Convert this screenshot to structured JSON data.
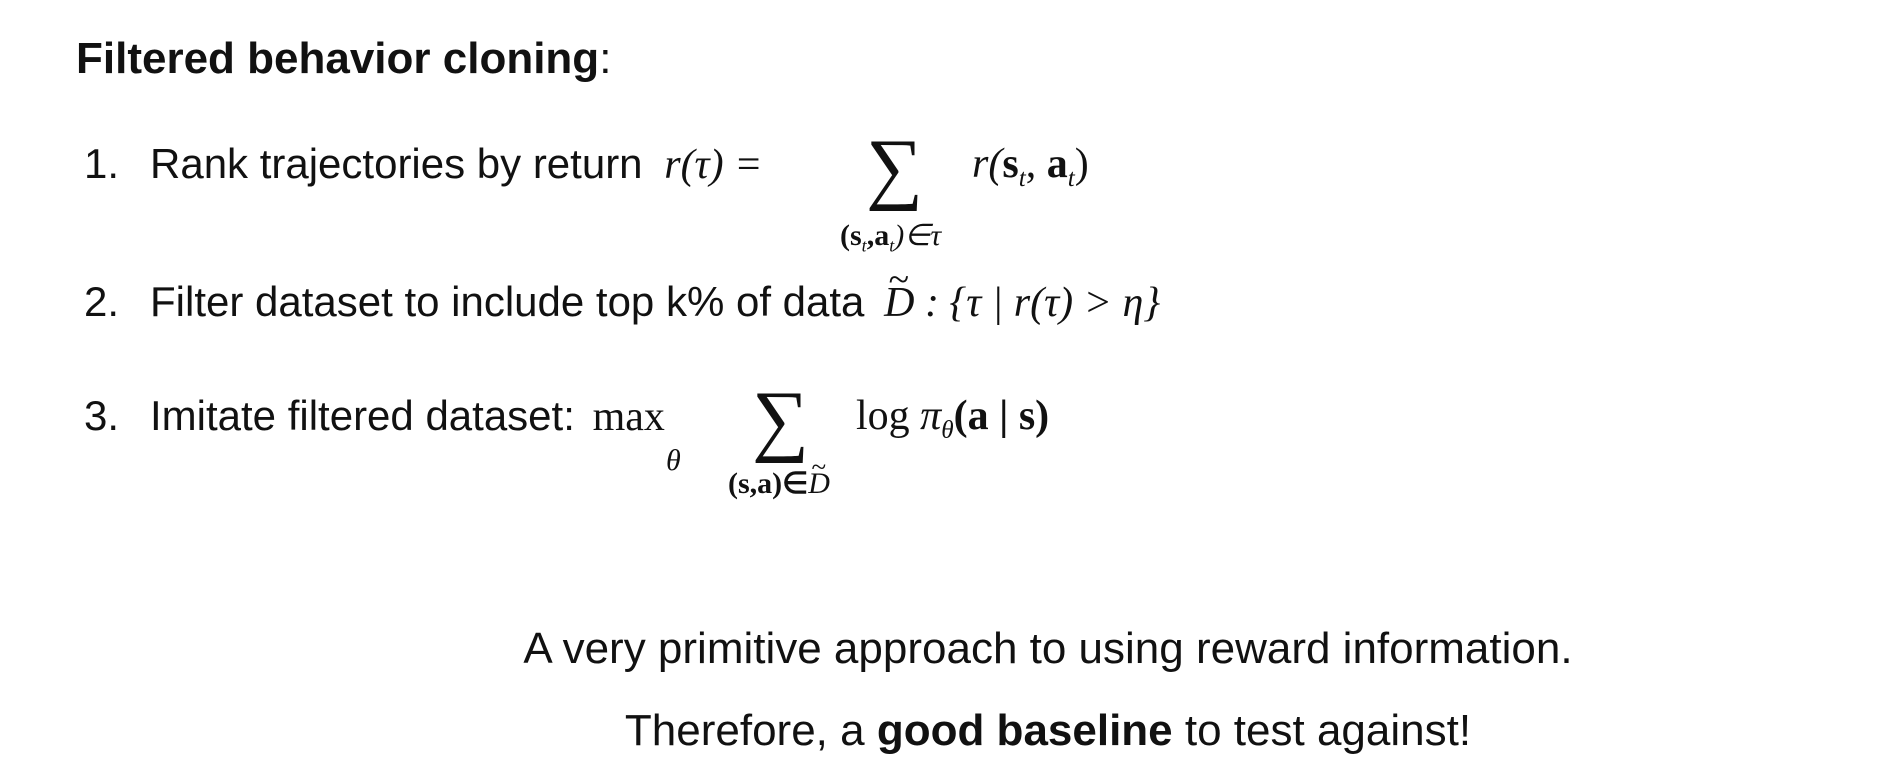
{
  "heading": {
    "bold": "Filtered behavior cloning",
    "colon": ":"
  },
  "items": [
    {
      "number": "1.",
      "text": "Rank trajectories by return",
      "math": {
        "lhs": "r(τ) =",
        "sigma": "∑",
        "under": "(s",
        "under_t1": "t",
        "under_mid": ",a",
        "under_t2": "t",
        "under_end": ")∈τ",
        "term_r": "r(",
        "term_s": "s",
        "term_t1": "t",
        "term_comma": ", ",
        "term_a": "a",
        "term_t2": "t",
        "term_close": ")"
      }
    },
    {
      "number": "2.",
      "text": "Filter dataset to include top k% of data",
      "math": {
        "D": "D",
        "set": ": {τ | r(τ) > η}"
      }
    },
    {
      "number": "3.",
      "text": "Imitate filtered dataset:",
      "math": {
        "max": "max",
        "theta": "θ",
        "sigma": "∑",
        "under": "(s,a)∈",
        "under_D": "D",
        "log": "log",
        "pi": "π",
        "pi_sub": "θ",
        "arg": "(a | s)"
      }
    }
  ],
  "notes": {
    "line1": "A very primitive approach to using reward information.",
    "line2_pre": "Therefore, a ",
    "line2_bold": "good baseline",
    "line2_post": " to test against!"
  }
}
